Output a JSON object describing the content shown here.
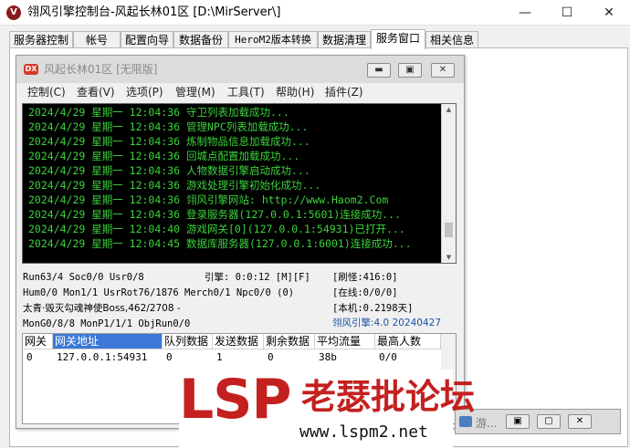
{
  "window": {
    "title": "翎风引擎控制台-风起长林01区 [D:\\MirServer\\]",
    "minimize": "—",
    "maximize": "☐",
    "close": "✕"
  },
  "tabs": [
    "服务器控制",
    "帐号",
    "配置向导",
    "数据备份",
    "HeroM2版本转换",
    "数据清理",
    "服务窗口",
    "相关信息"
  ],
  "active_tab": "服务窗口",
  "server_window": {
    "icon_text": "DX",
    "title": "风起长林01区 [无限版]",
    "menu": [
      "控制(C)",
      "查看(V)",
      "选项(P)",
      "管理(M)",
      "工具(T)",
      "帮助(H)",
      "插件(Z)"
    ],
    "log": [
      "2024/4/29 星期一 12:04:36 守卫列表加载成功...",
      "2024/4/29 星期一 12:04:36 管理NPC列表加载成功...",
      "2024/4/29 星期一 12:04:36 炼制物品信息加载成功...",
      "2024/4/29 星期一 12:04:36 回城点配置加载成功...",
      "2024/4/29 星期一 12:04:36 人物数据引擎启动成功...",
      "2024/4/29 星期一 12:04:36 游戏处理引擎初始化成功...",
      "2024/4/29 星期一 12:04:36 翎风引擎网站: http://www.Haom2.Com",
      "2024/4/29 星期一 12:04:36 登录服务器(127.0.0.1:5601)连接成功...",
      "2024/4/29 星期一 12:04:40 游戏网关[0](127.0.0.1:54931)已打开...",
      "2024/4/29 星期一 12:04:45 数据库服务器(127.0.0.1:6001)连接成功..."
    ],
    "status": {
      "run": "Run63/4 Soc0/0 Usr0/8",
      "engine": "引擎: 0:0:12 [M][F]",
      "refresh": "[刷怪:416:0]",
      "hum": "Hum0/0 Mon1/1 UsrRot76/1876 Merch0/1 Npc0/0 (0)",
      "online": "[在线:0/0/0]",
      "boss": "太青·毁灭勾魂神使Boss,462/2708 -",
      "local": "[本机:0.2198天]",
      "mongo": "MonG0/8/8 MonP1/1/1 ObjRun0/0",
      "version": "翎风引擎:4.0 20240427"
    },
    "grid": {
      "headers": [
        "网关",
        "网关地址",
        "队列数据",
        "发送数据",
        "剩余数据",
        "平均流量",
        "最高人数"
      ],
      "selected_header": "网关地址",
      "rows": [
        [
          "0",
          "127.0.0.1:54931",
          "0",
          "1",
          "0",
          "38b",
          "0/0"
        ]
      ]
    }
  },
  "taskbar_item": "游...",
  "watermark": {
    "logo": "LSP",
    "name": "老瑟批论坛",
    "url": "www.lspm2.net"
  }
}
